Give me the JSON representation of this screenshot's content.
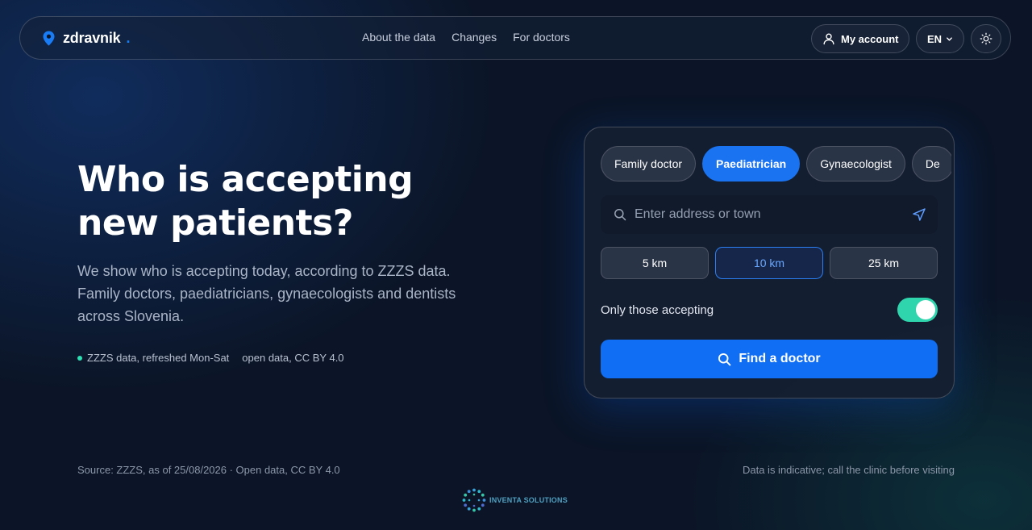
{
  "brand": {
    "name": "zdravnik",
    "dot": "."
  },
  "nav": {
    "links": [
      "About the data",
      "Changes",
      "For doctors"
    ],
    "account_label": "My account",
    "language": "EN"
  },
  "hero": {
    "title_line1": "Who is accepting",
    "title_line2": "new patients?",
    "description": "We show who is accepting today, according to ZZZS data. Family doctors, paediatricians, gynaecologists and dentists across Slovenia.",
    "status_text": "ZZZS data, refreshed Mon-Sat",
    "license_text": "open data, CC BY 4.0"
  },
  "search": {
    "tabs": [
      {
        "label": "Family doctor",
        "active": false
      },
      {
        "label": "Paediatrician",
        "active": true
      },
      {
        "label": "Gynaecologist",
        "active": false
      },
      {
        "label": "De",
        "active": false
      }
    ],
    "placeholder": "Enter address or town",
    "radius_options": [
      {
        "label": "5 km",
        "active": false
      },
      {
        "label": "10 km",
        "active": true
      },
      {
        "label": "25 km",
        "active": false
      }
    ],
    "toggle_label": "Only those accepting",
    "toggle_on": true,
    "submit_label": "Find a doctor"
  },
  "footer": {
    "source": "Source: ZZZS, as of 25/08/2026 · Open data, CC BY 4.0",
    "disclaimer": "Data is indicative; call the clinic before visiting",
    "company": "INVENTA SOLUTIONS"
  },
  "colors": {
    "background": "#0b1527",
    "accent": "#1a73f0",
    "toggle_on": "#2fd6ad",
    "status_dot": "#2fe0b5"
  },
  "icons": [
    "map-pin-icon",
    "user-icon",
    "chevron-down-icon",
    "sun-icon",
    "search-icon",
    "navigation-arrow-icon"
  ]
}
